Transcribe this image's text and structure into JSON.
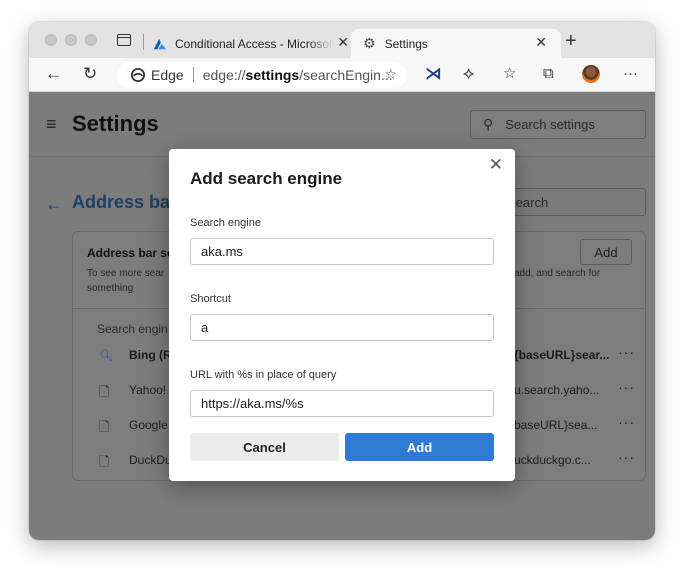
{
  "tabs": [
    {
      "title": "Conditional Access - Microsoft Azure",
      "icon": "azure-logo-icon"
    },
    {
      "title": "Settings",
      "icon": "gear-icon"
    }
  ],
  "toolbar": {
    "site_name": "Edge",
    "url_prefix": "edge://",
    "url_host": "settings",
    "url_path": "/searchEngin..."
  },
  "settings": {
    "title": "Settings",
    "search_placeholder": "Search settings",
    "page_title": "Address bar",
    "search_box_2": "Search",
    "card_title": "Address bar se",
    "card_desc": "To see more sear",
    "card_desc_right": "add, and search for",
    "card_desc2": "something",
    "add_button": "Add",
    "list_header": "Search engin",
    "rows": [
      {
        "name": "Bing (R",
        "url": "{baseURL}sear...",
        "bold": true,
        "icon": "search-icon"
      },
      {
        "name": "Yahoo!",
        "url": "u.search.yaho...",
        "bold": false,
        "icon": "document-icon"
      },
      {
        "name": "Google",
        "url": "baseURL}sea...",
        "bold": false,
        "icon": "document-icon"
      },
      {
        "name": "DuckDu",
        "url": "uckduckgo.c...",
        "bold": false,
        "icon": "document-icon"
      }
    ]
  },
  "dialog": {
    "title": "Add search engine",
    "search_engine_label": "Search engine",
    "search_engine_value": "aka.ms",
    "shortcut_label": "Shortcut",
    "shortcut_value": "a",
    "url_label": "URL with %s in place of query",
    "url_value": "https://aka.ms/%s",
    "cancel_label": "Cancel",
    "add_label": "Add"
  },
  "colors": {
    "accent": "#2f7bd4",
    "overlay": "#7c7c7c"
  }
}
